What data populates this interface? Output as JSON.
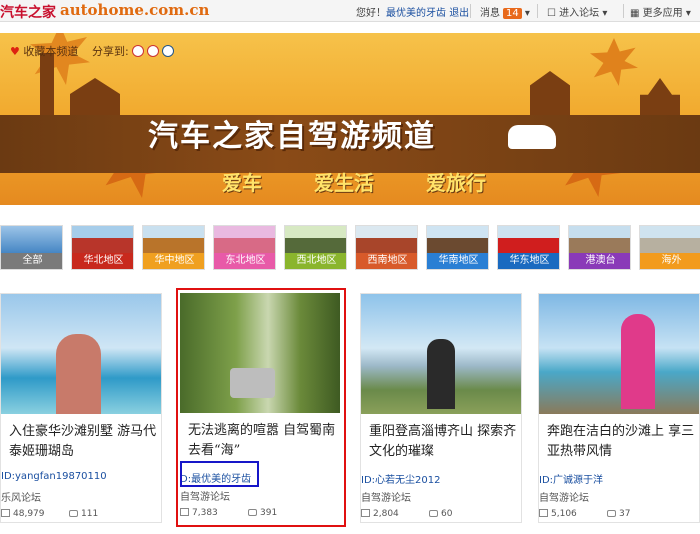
{
  "header": {
    "logo_cn": "汽车之家",
    "logo_url": "autohome.com.cn",
    "greeting": "您好！",
    "username": "最优美的牙齿",
    "logout": "退出",
    "messages_label": "消息",
    "messages_count": "14",
    "forum_entry": "进入论坛",
    "more_apps": "更多应用"
  },
  "banner": {
    "bookmark": "收藏本频道",
    "share_label": "分享到:",
    "title": "汽车之家自驾游频道",
    "slogans": [
      "爱车",
      "爱生活",
      "爱旅行"
    ],
    "accent_color": "#f1a62a"
  },
  "regions": [
    {
      "label": "全部"
    },
    {
      "label": "华北地区"
    },
    {
      "label": "华中地区"
    },
    {
      "label": "东北地区"
    },
    {
      "label": "西北地区"
    },
    {
      "label": "西南地区"
    },
    {
      "label": "华南地区"
    },
    {
      "label": "华东地区"
    },
    {
      "label": "港澳台"
    },
    {
      "label": "海外"
    }
  ],
  "cards": [
    {
      "title": "入住豪华沙滩别墅 游马代 泰姬珊瑚岛",
      "author": "ID:yangfan19870110",
      "forum": "乐风论坛",
      "views": "48,979",
      "replies": "111"
    },
    {
      "title": "无法逃离的喧嚣 自驾蜀南 去看“海”",
      "author": "D:最优美的牙齿",
      "forum": "自驾游论坛",
      "views": "7,383",
      "replies": "391"
    },
    {
      "title": "重阳登高淄博齐山 探索齐 文化的璀璨",
      "author": "ID:心若无尘2012",
      "forum": "自驾游论坛",
      "views": "2,804",
      "replies": "60"
    },
    {
      "title": "奔跑在洁白的沙滩上 享三 亚热带风情",
      "author": "ID:广诚源于洋",
      "forum": "自驾游论坛",
      "views": "5,106",
      "replies": "37"
    }
  ]
}
